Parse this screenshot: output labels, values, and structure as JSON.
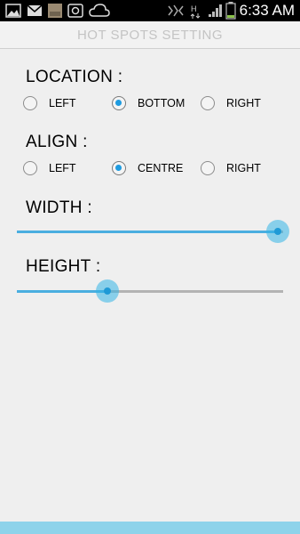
{
  "status_bar": {
    "time": "6:33 AM",
    "icons": [
      "gallery-icon",
      "mail-icon",
      "photo-thumbnail-icon",
      "app-icon",
      "cloud-icon",
      "vibrate-icon",
      "hsdpa-data-icon",
      "signal-icon",
      "battery-icon"
    ]
  },
  "title": "HOT SPOTS SETTING",
  "location": {
    "label": "LOCATION :",
    "options": [
      "LEFT",
      "BOTTOM",
      "RIGHT"
    ],
    "selected": "BOTTOM"
  },
  "align": {
    "label": "ALIGN :",
    "options": [
      "LEFT",
      "CENTRE",
      "RIGHT"
    ],
    "selected": "CENTRE"
  },
  "width": {
    "label": "WIDTH :",
    "value_fraction": 0.98
  },
  "height": {
    "label": "HEIGHT :",
    "value_fraction": 0.34
  },
  "colors": {
    "accent": "#33b5e5",
    "radio_checked": "#1e9be0",
    "bottom_bar": "#8ed3ea"
  }
}
